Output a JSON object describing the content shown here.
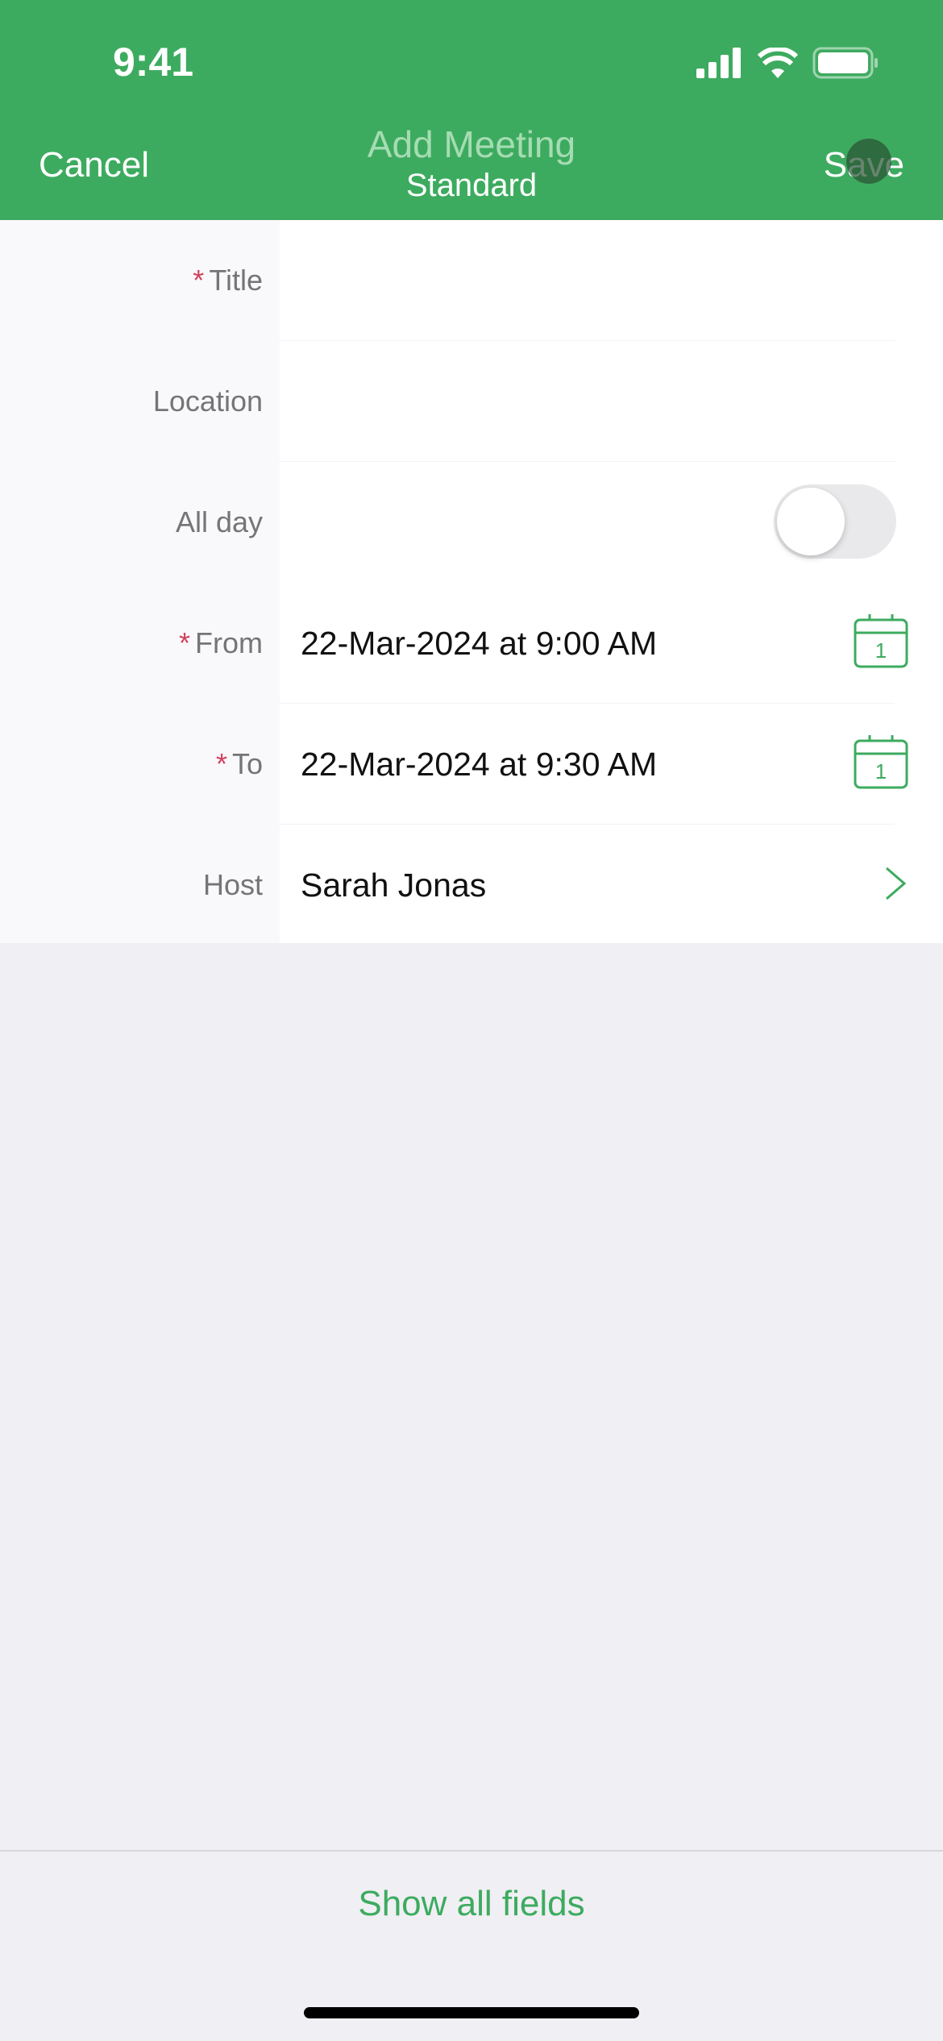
{
  "status_bar": {
    "time": "9:41",
    "icons": [
      "signal-icon",
      "wifi-icon",
      "battery-icon"
    ]
  },
  "nav": {
    "cancel_label": "Cancel",
    "title": "Add Meeting",
    "subtitle": "Standard",
    "save_label": "Save"
  },
  "colors": {
    "accent": "#3dab5f",
    "required": "#d1435b"
  },
  "form": {
    "title": {
      "label": "Title",
      "required": "*",
      "value": ""
    },
    "location": {
      "label": "Location",
      "value": ""
    },
    "all_day": {
      "label": "All day",
      "on": false
    },
    "from": {
      "label": "From",
      "required": "*",
      "value": "22-Mar-2024 at 9:00 AM",
      "icon_day": "1"
    },
    "to": {
      "label": "To",
      "required": "*",
      "value": "22-Mar-2024 at 9:30 AM",
      "icon_day": "1"
    },
    "host": {
      "label": "Host",
      "value": "Sarah Jonas"
    }
  },
  "footer": {
    "show_all_label": "Show all fields"
  }
}
